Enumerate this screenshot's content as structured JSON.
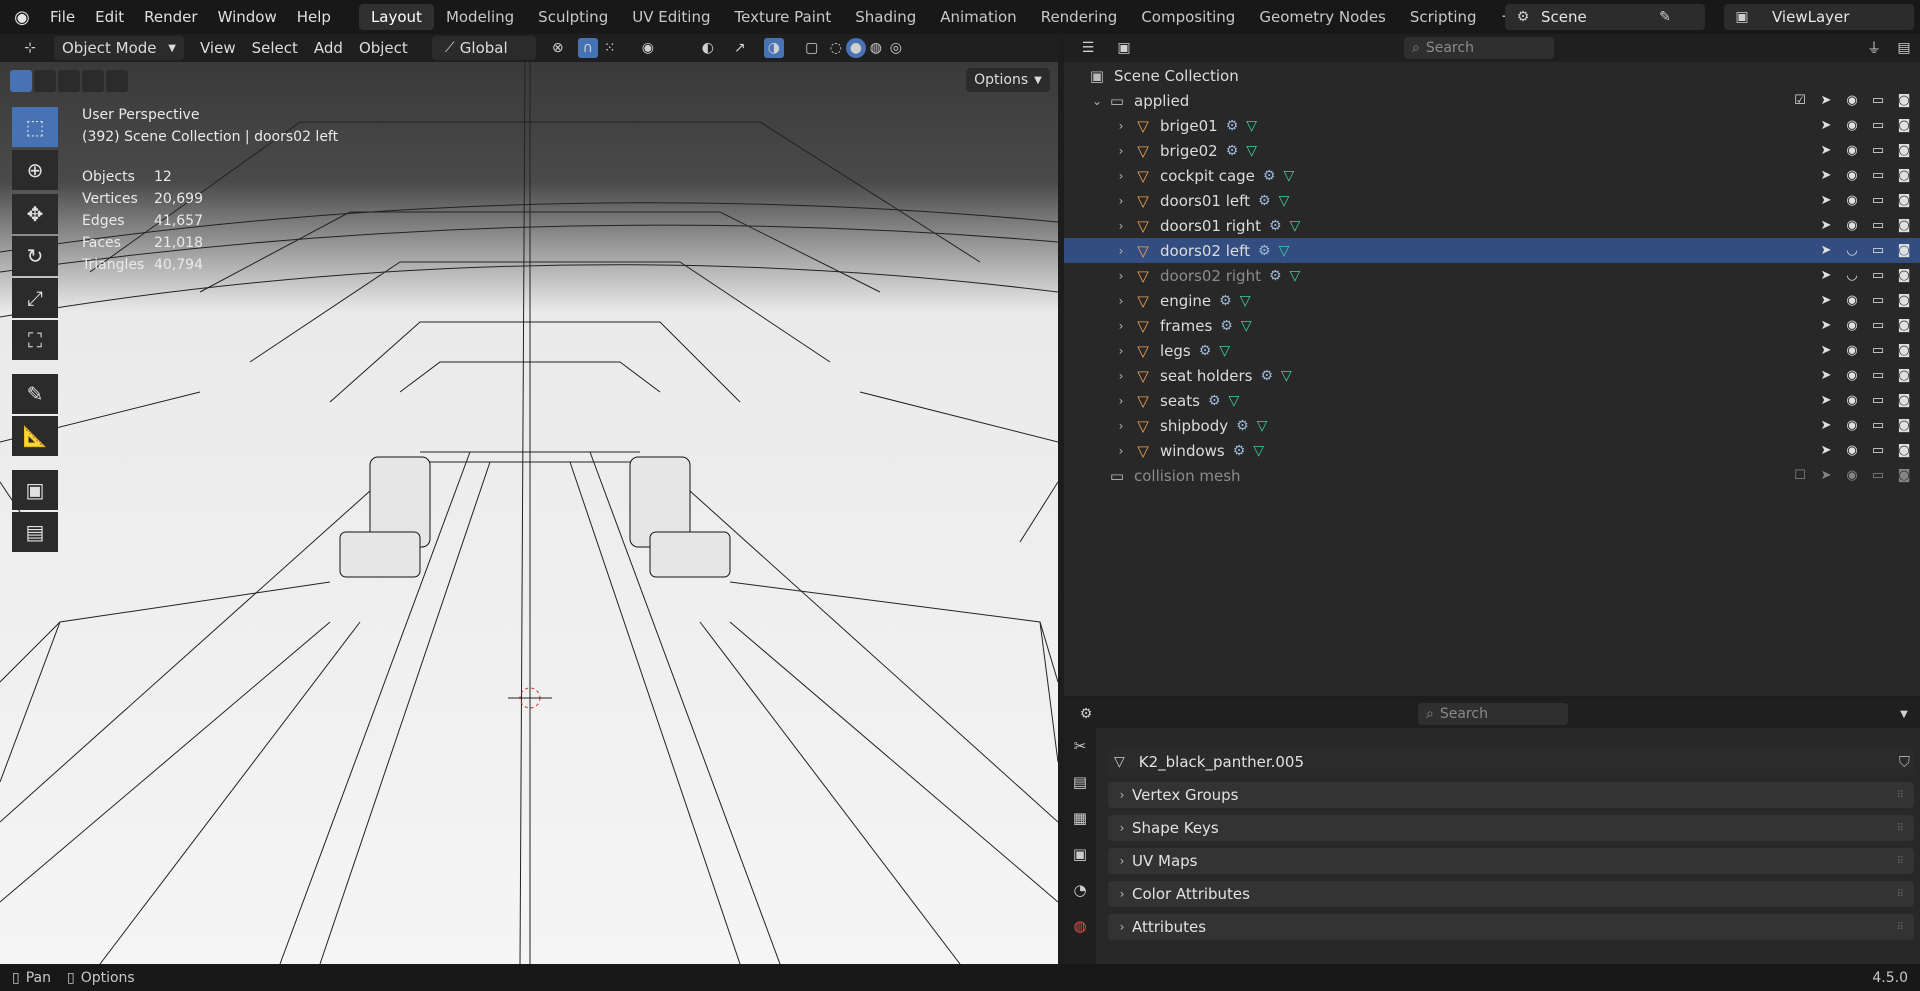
{
  "menu": [
    "File",
    "Edit",
    "Render",
    "Window",
    "Help"
  ],
  "workspaces": [
    "Layout",
    "Modeling",
    "Sculpting",
    "UV Editing",
    "Texture Paint",
    "Shading",
    "Animation",
    "Rendering",
    "Compositing",
    "Geometry Nodes",
    "Scripting"
  ],
  "active_workspace": "Layout",
  "scene_name": "Scene",
  "view_layer": "ViewLayer",
  "viewport_header": {
    "mode": "Object Mode",
    "menus": [
      "View",
      "Select",
      "Add",
      "Object"
    ],
    "transform_orientation": "Global",
    "options_label": "Options"
  },
  "viewport_info": {
    "perspective": "User Perspective",
    "context": "(392) Scene Collection | doors02 left",
    "stats": [
      {
        "label": "Objects",
        "value": "12"
      },
      {
        "label": "Vertices",
        "value": "20,699"
      },
      {
        "label": "Edges",
        "value": "41,657"
      },
      {
        "label": "Faces",
        "value": "21,018"
      },
      {
        "label": "Triangles",
        "value": "40,794"
      }
    ]
  },
  "outliner": {
    "search_placeholder": "Search",
    "root": "Scene Collection",
    "collection": "applied",
    "objects": [
      "brige01",
      "brige02",
      "cockpit cage",
      "doors01 left",
      "doors01 right",
      "doors02 left",
      "doors02 right",
      "engine",
      "frames",
      "legs",
      "seat holders",
      "seats",
      "shipbody",
      "windows"
    ],
    "selected": "doors02 left",
    "hidden": [
      "doors02 left",
      "doors02 right"
    ],
    "extra_collection": "collision mesh"
  },
  "properties": {
    "search_placeholder": "Search",
    "mesh_name": "K2_black_panther.005",
    "panels": [
      "Vertex Groups",
      "Shape Keys",
      "UV Maps",
      "Color Attributes",
      "Attributes"
    ]
  },
  "statusbar": {
    "pan_label": "Pan",
    "options_label": "Options",
    "version": "4.5.0"
  }
}
